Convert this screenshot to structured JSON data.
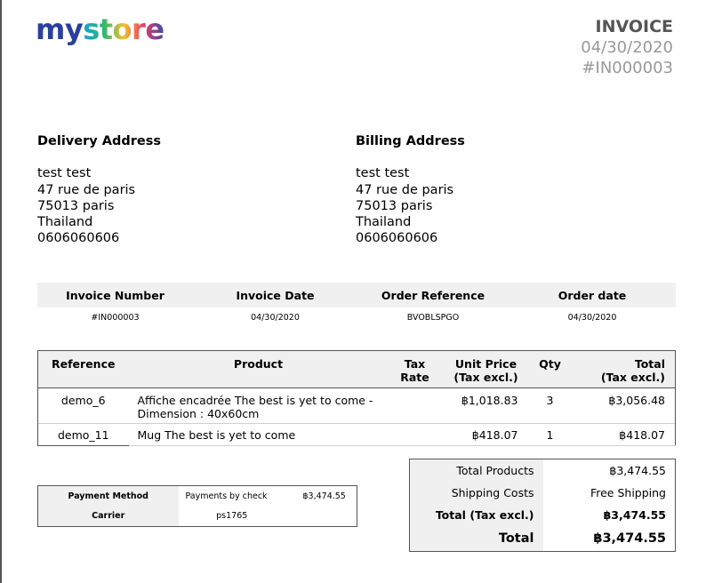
{
  "logo": {
    "part1": "my",
    "part2": " store"
  },
  "invoice_header": {
    "title": "INVOICE",
    "date": "04/30/2020",
    "number": "#IN000003"
  },
  "delivery_address": {
    "heading": "Delivery Address",
    "lines": [
      "test test",
      "47 rue de paris",
      "75013 paris",
      "Thailand",
      "0606060606"
    ]
  },
  "billing_address": {
    "heading": "Billing Address",
    "lines": [
      "test test",
      "47 rue de paris",
      "75013 paris",
      "Thailand",
      "0606060606"
    ]
  },
  "meta": {
    "headers": [
      "Invoice Number",
      "Invoice Date",
      "Order Reference",
      "Order date"
    ],
    "values": [
      "#IN000003",
      "04/30/2020",
      "BVOBLSPGO",
      "04/30/2020"
    ]
  },
  "items": {
    "headers": {
      "reference": "Reference",
      "product": "Product",
      "tax_rate_1": "Tax",
      "tax_rate_2": "Rate",
      "unit_price_1": "Unit Price",
      "unit_price_2": "(Tax excl.)",
      "qty": "Qty",
      "total_1": "Total",
      "total_2": "(Tax excl.)"
    },
    "rows": [
      {
        "reference": "demo_6",
        "product_line1": "Affiche encadrée The best is yet to come -",
        "product_line2": "Dimension : 40x60cm",
        "tax_rate": "",
        "unit_price": "฿1,018.83",
        "qty": "3",
        "total": "฿3,056.48"
      },
      {
        "reference": "demo_11",
        "product_line1": "Mug The best is yet to come",
        "product_line2": "",
        "tax_rate": "",
        "unit_price": "฿418.07",
        "qty": "1",
        "total": "฿418.07"
      }
    ]
  },
  "payment": {
    "method_label": "Payment Method",
    "method_value": "Payments by check",
    "method_amount": "฿3,474.55",
    "carrier_label": "Carrier",
    "carrier_value": "ps1765"
  },
  "totals": {
    "total_products_label": "Total Products",
    "total_products_value": "฿3,474.55",
    "shipping_label": "Shipping Costs",
    "shipping_value": "Free Shipping",
    "total_tax_excl_label": "Total (Tax excl.)",
    "total_tax_excl_value": "฿3,474.55",
    "total_label": "Total",
    "total_value": "฿3,474.55"
  },
  "colors": {
    "header_bg": "#f0f0f0",
    "muted_text": "#999999",
    "title_text": "#555555"
  }
}
